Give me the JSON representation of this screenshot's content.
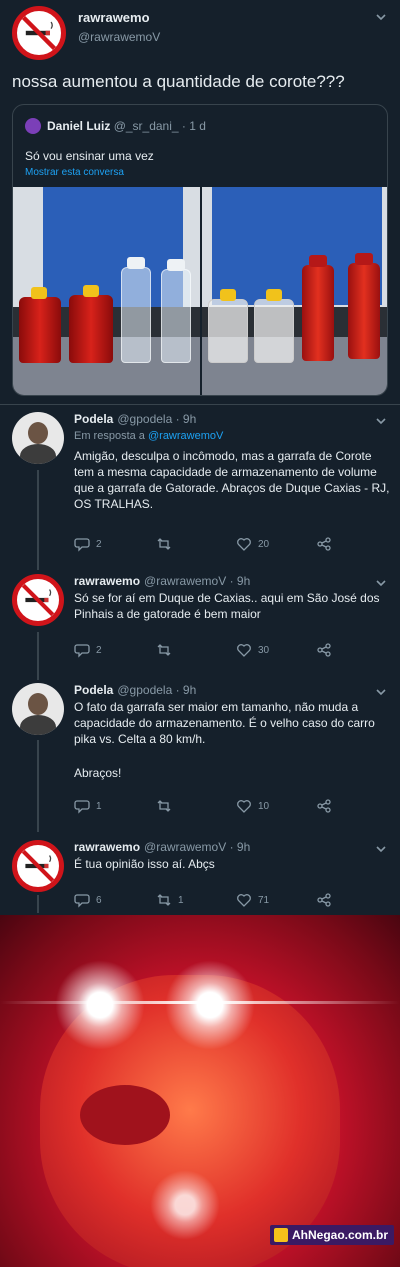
{
  "main_tweet": {
    "name": "rawrawemo",
    "handle": "@rawrawemoV",
    "text": "nossa aumentou a quantidade de corote???"
  },
  "quote": {
    "name": "Daniel Luiz",
    "handle": "@_sr_dani_",
    "time": "· 1 d",
    "text": "Só vou ensinar uma vez",
    "show_thread": "Mostrar esta conversa"
  },
  "replies": [
    {
      "name": "Podela",
      "handle": "@gpodela · 9h",
      "reply_to_prefix": "Em resposta a",
      "reply_to_handle": "@rawrawemoV",
      "text": "Amigão, desculpa o incômodo, mas a garrafa de Corote tem a mesma capacidade de armazenamento de volume que a garrafa de Gatorade. Abraços de Duque Caxias - RJ, OS TRALHAS.",
      "replies": "2",
      "retweets": "",
      "likes": "20"
    },
    {
      "name": "rawrawemo",
      "handle": "@rawrawemoV · 9h",
      "text": "Só se for aí em Duque de Caxias.. aqui em São José dos Pinhais a de gatorade é bem maior",
      "replies": "2",
      "retweets": "",
      "likes": "30"
    },
    {
      "name": "Podela",
      "handle": "@gpodela · 9h",
      "text": "O fato da garrafa ser maior em tamanho, não muda a capacidade do armazenamento. É o velho caso do carro pika vs. Celta a 80 km/h.",
      "text2": "Abraços!",
      "replies": "1",
      "retweets": "",
      "likes": "10"
    },
    {
      "name": "rawrawemo",
      "handle": "@rawrawemoV · 9h",
      "text": "É tua opinião isso aí. Abçs",
      "replies": "6",
      "retweets": "1",
      "likes": "71"
    }
  ],
  "watermark": "AhNegao.com.br",
  "colors": {
    "background": "#15202b",
    "link": "#1da1f2",
    "muted": "#8899a6",
    "no_smoking_red": "#d0141a"
  }
}
